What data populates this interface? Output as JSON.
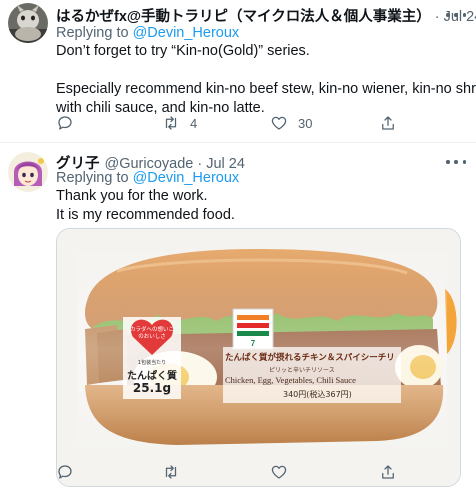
{
  "tweets": [
    {
      "name": "はるかぜfx@手動トラリピ（マイクロ法人＆個人事業主）",
      "handle": "",
      "date": "· Jul 24",
      "replying_prefix": "Replying to ",
      "replying_handle": "@Devin_Heroux",
      "lines": [
        "Don’t forget to try “Kin-no(Gold)” series.",
        "",
        "Especially recommend kin-no beef stew, kin-no wiener, kin-no shrimp",
        "with chili sauce, and kin-no latte."
      ],
      "actions": {
        "reply_icon": "reply-icon",
        "retweet_icon": "retweet-icon",
        "retweet_count": "4",
        "like_icon": "heart-icon",
        "like_count": "30",
        "share_icon": "share-icon"
      }
    },
    {
      "name": "グリ子",
      "handle": "@Guricoyade",
      "date": "· Jul 24",
      "replying_prefix": "Replying to ",
      "replying_handle": "@Devin_Heroux",
      "lines": [
        "Thank you for the work.",
        "It is my recommended food."
      ],
      "media": {
        "package_text_main": "たんぱく質が摂れるチキン＆スパイシーチリ",
        "package_text_sub": "ピリッと辛いチリソース",
        "package_text_en": "Chicken, Egg, Vegetables, Chili Sauce",
        "package_price": "340円(税込367円)",
        "badge_top": "カラダへの想いこのおいしさ",
        "badge_protein_label": "たんぱく質",
        "badge_protein_value": "25.1g",
        "badge_small": "1包装当たり"
      },
      "actions": {
        "reply_icon": "reply-icon",
        "retweet_icon": "retweet-icon",
        "retweet_count": "",
        "like_icon": "heart-icon",
        "like_count": "",
        "share_icon": "share-icon"
      }
    }
  ],
  "colors": {
    "link": "#1d9bf0",
    "secondary": "#536471",
    "divider": "#eff3f4"
  }
}
